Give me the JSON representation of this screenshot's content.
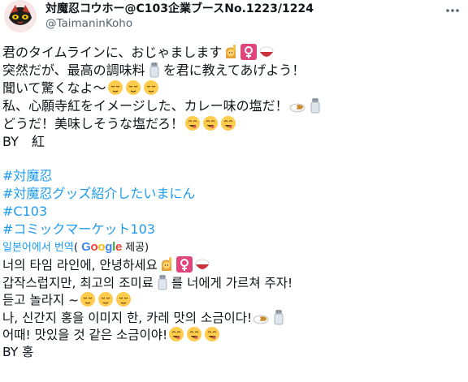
{
  "tweet": {
    "author": {
      "display_name": "対魔忍コウホー@C103企業ブースNo.1223/1224",
      "handle": "@TaimaninKoho"
    },
    "more_icon": "more-horizontal-icon",
    "text_lines": [
      "君のタイムラインに、おじゃまします",
      "突然だが、最高の調味料",
      "を君に教えてあげよう！",
      "聞いて驚くなよ〜",
      "私、心願寺紅をイメージした、カレー味の塩だ！",
      "どうだ！美味しそうな塩だろ！",
      "BY　紅"
    ],
    "hashtags": [
      "#対魔忍",
      "#対魔忍グッズ紹介したいまにん",
      "#C103",
      "#コミックマーケット103"
    ],
    "translation": {
      "link_label": "일본어에서 번역",
      "paren_open": "(",
      "provider": "Google",
      "suffix": " 제공)",
      "lines": [
        "너의 타임 라인에, 안녕하세요",
        "갑작스럽지만, 최고의 조미료",
        "를 너에게 가르쳐 주자!",
        "듣고 놀라지 ~",
        "나, 신간지 홍을 이미지 한, 카레 맛의 소금이다!",
        "어때! 맛있을 것 같은 소금이야!",
        "BY 홍"
      ]
    },
    "emoji_names": [
      "person-raising-hand-emoji",
      "female-sign-emoji",
      "rice-bowl-emoji",
      "salt-shaker-emoji",
      "relieved-face-emoji",
      "curry-plate-emoji",
      "yum-face-emoji"
    ],
    "colors": {
      "link": "#1d9bf0",
      "secondary_text": "#536471",
      "google_blue": "#4285f4",
      "google_red": "#ea4335",
      "google_yellow": "#fbbc05",
      "google_green": "#34a853"
    }
  }
}
